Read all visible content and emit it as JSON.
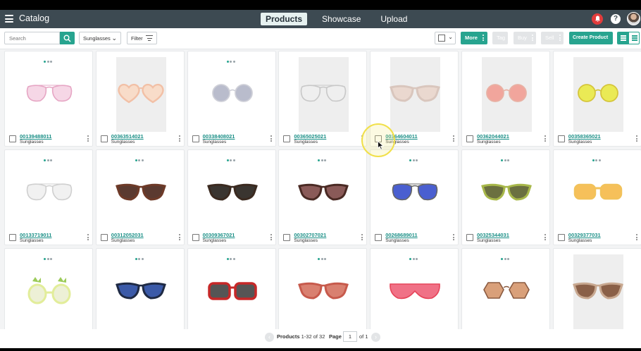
{
  "header": {
    "app_title": "Catalog",
    "tabs": [
      {
        "label": "Products",
        "active": true
      },
      {
        "label": "Showcase",
        "active": false
      },
      {
        "label": "Upload",
        "active": false
      }
    ],
    "help_label": "?"
  },
  "toolbar": {
    "search_placeholder": "Search",
    "category_select": "Sunglasses",
    "filter_label": "Filter",
    "more_label": "More",
    "tag_label": "Tag",
    "buy_label": "Buy",
    "sell_label": "Sell",
    "create_label": "Create Product"
  },
  "products": [
    {
      "sku": "00139488011",
      "category": "Sunglasses",
      "frame": "#e6a6c4",
      "lens": "#f6d7e6",
      "shape": "aviator",
      "bg": false
    },
    {
      "sku": "00363514021",
      "category": "Sunglasses",
      "frame": "#f2c0a6",
      "lens": "#f8dcc9",
      "shape": "heart",
      "bg": true
    },
    {
      "sku": "00338408021",
      "category": "Sunglasses",
      "frame": "#cfd0d8",
      "lens": "#b9bccc",
      "shape": "round",
      "bg": false
    },
    {
      "sku": "00365025021",
      "category": "Sunglasses",
      "frame": "#c8c8c8",
      "lens": "#efefef",
      "shape": "aviator",
      "bg": true
    },
    {
      "sku": "00364604011",
      "category": "Sunglasses",
      "frame": "#d9c6bd",
      "lens": "#ead8cf",
      "shape": "cateye",
      "bg": true
    },
    {
      "sku": "00362044021",
      "category": "Sunglasses",
      "frame": "#e8b1a4",
      "lens": "#f1a59c",
      "shape": "round",
      "bg": true
    },
    {
      "sku": "00358365021",
      "category": "Sunglasses",
      "frame": "#d5c53a",
      "lens": "#eaea55",
      "shape": "round",
      "bg": true
    },
    {
      "sku": "00133719011",
      "category": "Sunglasses",
      "frame": "#cfcfcf",
      "lens": "#f1f1f1",
      "shape": "aviator",
      "bg": false
    },
    {
      "sku": "00312052031",
      "category": "Sunglasses",
      "frame": "#6e3a28",
      "lens": "#5b3a30",
      "shape": "cateye",
      "bg": false
    },
    {
      "sku": "00309367021",
      "category": "Sunglasses",
      "frame": "#3b2a20",
      "lens": "#3a3530",
      "shape": "cateye",
      "bg": false
    },
    {
      "sku": "00302707021",
      "category": "Sunglasses",
      "frame": "#4a2a24",
      "lens": "#8a5a58",
      "shape": "cateye",
      "bg": false
    },
    {
      "sku": "00268689011",
      "category": "Sunglasses",
      "frame": "#666666",
      "lens": "#4a5fd0",
      "shape": "aviator",
      "bg": false
    },
    {
      "sku": "00325344031",
      "category": "Sunglasses",
      "frame": "#a8b84a",
      "lens": "#6b7040",
      "shape": "cateye",
      "bg": false
    },
    {
      "sku": "00329377031",
      "category": "Sunglasses",
      "frame": "#f2c25a",
      "lens": "#f6c05a",
      "shape": "wide",
      "bg": false
    },
    {
      "sku": "",
      "category": "",
      "frame": "#e2ed9a",
      "lens": "#edf0d6",
      "shape": "pineapple",
      "bg": false
    },
    {
      "sku": "",
      "category": "",
      "frame": "#1f2a44",
      "lens": "#3b5aa8",
      "shape": "cateye",
      "bg": false
    },
    {
      "sku": "",
      "category": "",
      "frame": "#c62828",
      "lens": "#555555",
      "shape": "square",
      "bg": false
    },
    {
      "sku": "",
      "category": "",
      "frame": "#c75a4c",
      "lens": "#d98070",
      "shape": "cateye",
      "bg": false
    },
    {
      "sku": "",
      "category": "",
      "frame": "#e53c52",
      "lens": "#f06a80",
      "shape": "shield",
      "bg": false
    },
    {
      "sku": "",
      "category": "",
      "frame": "#8a5a40",
      "lens": "#d9a07a",
      "shape": "hex",
      "bg": false
    },
    {
      "sku": "",
      "category": "",
      "frame": "#c8a890",
      "lens": "#8a6048",
      "shape": "cateye",
      "bg": true
    }
  ],
  "pagination": {
    "products_label": "Products",
    "range": "1-32 of 32",
    "page_label": "Page",
    "page_value": "1",
    "of_pages": "of 1"
  },
  "colors": {
    "accent": "#27a48f",
    "topbar": "#3d4a52",
    "link": "#1a8f86",
    "alert": "#e23c3c"
  }
}
